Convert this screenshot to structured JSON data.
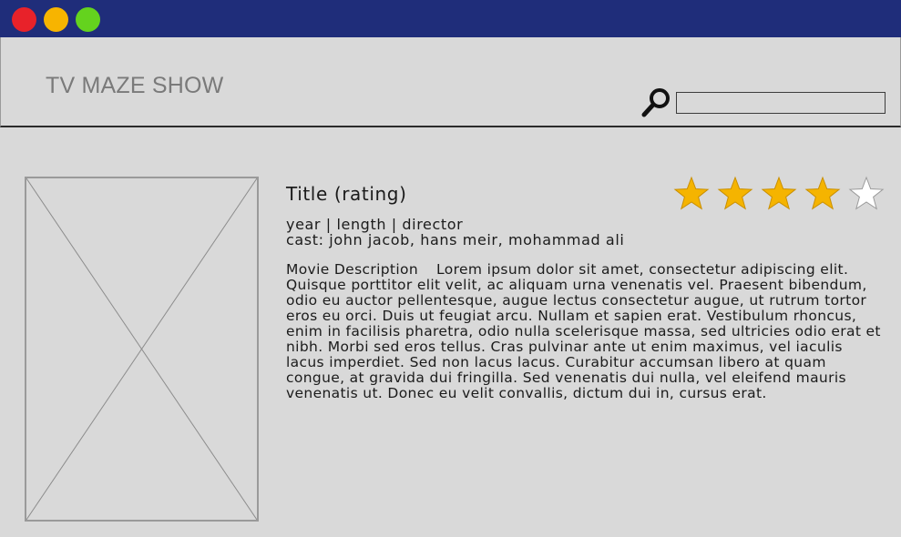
{
  "window": {
    "controls": [
      {
        "name": "close",
        "color": "#e8222a"
      },
      {
        "name": "minimize",
        "color": "#f7b400"
      },
      {
        "name": "maximize",
        "color": "#64d31e"
      }
    ],
    "titlebar_color": "#1f2d7a"
  },
  "header": {
    "brand": "TV MAZE SHOW",
    "search": {
      "icon": "magnifier-icon",
      "value": "",
      "placeholder": ""
    }
  },
  "show": {
    "poster": {
      "icon": "image-placeholder-icon"
    },
    "title": "Title (rating)",
    "meta_line": "year | length | director",
    "cast_line": "cast: john jacob, hans meir, mohammad ali",
    "description_label": "Movie Description",
    "description_text": "Lorem ipsum dolor sit amet, consectetur adipiscing elit. Quisque porttitor elit velit, ac aliquam urna venenatis vel. Praesent bibendum, odio eu auctor pellentesque, augue lectus consectetur augue, ut rutrum tortor eros eu orci. Duis ut feugiat arcu. Nullam et sapien erat. Vestibulum rhoncus, enim in facilisis pharetra, odio nulla scelerisque massa, sed ultricies odio erat et nibh. Morbi sed eros tellus. Cras pulvinar ante ut enim maximus, vel iaculis lacus imperdiet. Sed non lacus lacus. Curabitur accumsan libero at quam congue, at gravida dui fringilla. Sed venenatis dui nulla, vel eleifend mauris venenatis ut. Donec eu velit convallis, dictum dui in, cursus erat.",
    "rating": {
      "value": 4,
      "max": 5,
      "filled_color": "#f5b400",
      "empty_color": "#ffffff"
    }
  }
}
